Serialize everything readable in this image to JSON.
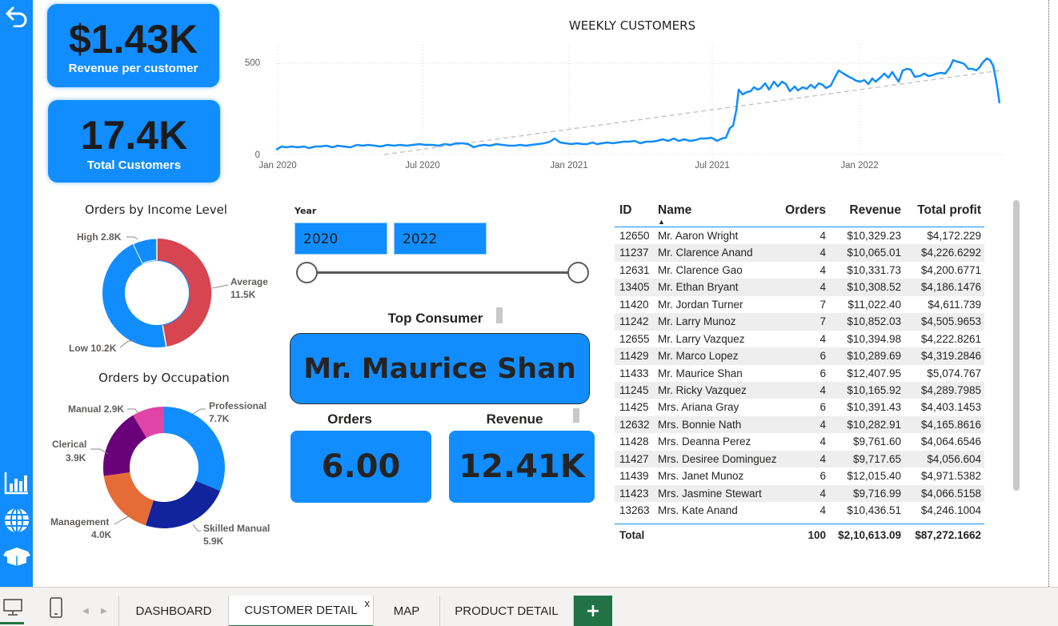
{
  "nav": {
    "back_icon": "back-arrow-icon",
    "icons": [
      "bar-chart-icon",
      "globe-icon",
      "box-icon"
    ]
  },
  "kpis": {
    "revenue_per_customer": {
      "value": "$1.43K",
      "label": "Revenue per customer"
    },
    "total_customers": {
      "value": "17.4K",
      "label": "Total Customers"
    }
  },
  "weekly_chart": {
    "title": "WEEKLY CUSTOMERS",
    "y_ticks": [
      "500",
      "0"
    ],
    "x_ticks": [
      "Jan 2020",
      "Jul 2020",
      "Jan 2021",
      "Jul 2021",
      "Jan 2022"
    ]
  },
  "income_donut": {
    "title": "Orders by Income Level",
    "labels": [
      {
        "name": "High",
        "value": "2.8K"
      },
      {
        "name": "Average",
        "value": "11.5K"
      },
      {
        "name": "Low",
        "value": "10.2K"
      }
    ]
  },
  "occupation_donut": {
    "title": "Orders by Occupation",
    "labels": [
      {
        "name": "Manual",
        "value": "2.9K"
      },
      {
        "name": "Professional",
        "value": "7.7K"
      },
      {
        "name": "Clerical",
        "value": "3.9K"
      },
      {
        "name": "Management",
        "value": "4.0K"
      },
      {
        "name": "Skilled Manual",
        "value": "5.9K"
      }
    ]
  },
  "year_slicer": {
    "label": "Year",
    "from": "2020",
    "to": "2022"
  },
  "top_consumer": {
    "title": "Top Consumer",
    "name": "Mr. Maurice Shan",
    "orders_label": "Orders",
    "orders_value": "6.00",
    "revenue_label": "Revenue",
    "revenue_value": "12.41K"
  },
  "table": {
    "headers": {
      "id": "ID",
      "name": "Name",
      "orders": "Orders",
      "revenue": "Revenue",
      "profit": "Total profit"
    },
    "rows": [
      {
        "id": "12650",
        "name": "Mr. Aaron Wright",
        "orders": "4",
        "revenue": "$10,329.23",
        "profit": "$4,172.229"
      },
      {
        "id": "11237",
        "name": "Mr. Clarence Anand",
        "orders": "4",
        "revenue": "$10,065.01",
        "profit": "$4,226.6292"
      },
      {
        "id": "12631",
        "name": "Mr. Clarence Gao",
        "orders": "4",
        "revenue": "$10,331.73",
        "profit": "$4,200.6771"
      },
      {
        "id": "13405",
        "name": "Mr. Ethan Bryant",
        "orders": "4",
        "revenue": "$10,308.52",
        "profit": "$4,186.1476"
      },
      {
        "id": "11420",
        "name": "Mr. Jordan Turner",
        "orders": "7",
        "revenue": "$11,022.40",
        "profit": "$4,611.739"
      },
      {
        "id": "11242",
        "name": "Mr. Larry Munoz",
        "orders": "7",
        "revenue": "$10,852.03",
        "profit": "$4,505.9653"
      },
      {
        "id": "12655",
        "name": "Mr. Larry Vazquez",
        "orders": "4",
        "revenue": "$10,394.98",
        "profit": "$4,222.8261"
      },
      {
        "id": "11429",
        "name": "Mr. Marco Lopez",
        "orders": "6",
        "revenue": "$10,289.69",
        "profit": "$4,319.2846"
      },
      {
        "id": "11433",
        "name": "Mr. Maurice Shan",
        "orders": "6",
        "revenue": "$12,407.95",
        "profit": "$5,074.767"
      },
      {
        "id": "11245",
        "name": "Mr. Ricky Vazquez",
        "orders": "4",
        "revenue": "$10,165.92",
        "profit": "$4,289.7985"
      },
      {
        "id": "11425",
        "name": "Mrs. Ariana Gray",
        "orders": "6",
        "revenue": "$10,391.43",
        "profit": "$4,403.1453"
      },
      {
        "id": "12632",
        "name": "Mrs. Bonnie Nath",
        "orders": "4",
        "revenue": "$10,282.91",
        "profit": "$4,165.8616"
      },
      {
        "id": "11428",
        "name": "Mrs. Deanna Perez",
        "orders": "4",
        "revenue": "$9,761.60",
        "profit": "$4,064.6546"
      },
      {
        "id": "11427",
        "name": "Mrs. Desiree Dominguez",
        "orders": "4",
        "revenue": "$9,717.65",
        "profit": "$4,056.604"
      },
      {
        "id": "11439",
        "name": "Mrs. Janet Munoz",
        "orders": "6",
        "revenue": "$12,015.40",
        "profit": "$4,971.5382"
      },
      {
        "id": "11423",
        "name": "Mrs. Jasmine Stewart",
        "orders": "4",
        "revenue": "$9,716.99",
        "profit": "$4,066.5158"
      },
      {
        "id": "13263",
        "name": "Mrs. Kate Anand",
        "orders": "4",
        "revenue": "$10,436.51",
        "profit": "$4,246.1004"
      }
    ],
    "total": {
      "label": "Total",
      "orders": "100",
      "revenue": "$2,10,613.09",
      "profit": "$87,272.1662"
    }
  },
  "tabs": [
    {
      "label": "DASHBOARD"
    },
    {
      "label": "CUSTOMER DETAIL",
      "active": true,
      "close": "x"
    },
    {
      "label": "MAP"
    },
    {
      "label": "PRODUCT DETAIL"
    }
  ],
  "add_tab_label": "+",
  "colors": {
    "accent": "#118DFF",
    "donut_red": "#D64550",
    "navy": "#12239E",
    "orange": "#E66C37",
    "purple": "#6B007B",
    "pink": "#E044A7",
    "tab_green": "#217346"
  }
}
